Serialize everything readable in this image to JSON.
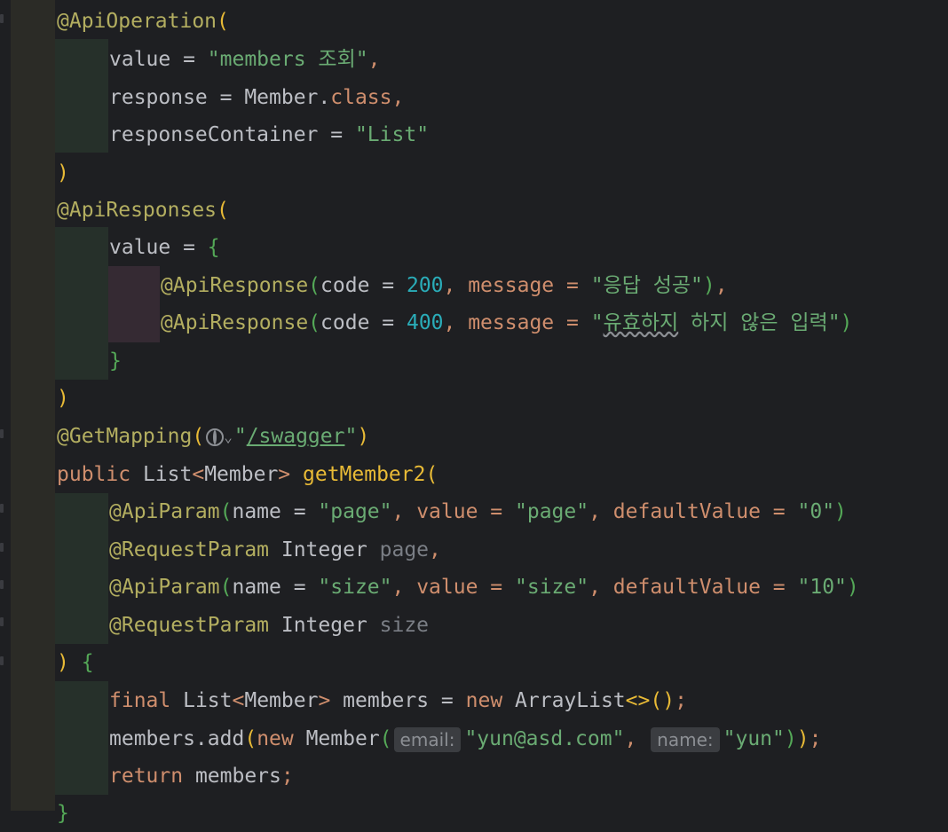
{
  "code": {
    "l1_annotation": "@ApiOperation",
    "l1_open": "(",
    "l2_key": "value = ",
    "l2_value": "\"members 조회\"",
    "l2_comma": ",",
    "l3_key": "response = Member.",
    "l3_kw": "class",
    "l3_comma": ",",
    "l4_key": "responseContainer = ",
    "l4_value": "\"List\"",
    "l5_close": ")",
    "l6_annotation": "@ApiResponses",
    "l6_open": "(",
    "l7_key": "value = ",
    "l7_brace": "{",
    "l8_annotation": "@ApiResponse",
    "l8_open": "(",
    "l8_code_key": "code = ",
    "l8_code_val": "200",
    "l8_msg_key": ", message = ",
    "l8_msg_val": "\"응답 성공\"",
    "l8_close": ")",
    "l8_comma": ",",
    "l9_annotation": "@ApiResponse",
    "l9_open": "(",
    "l9_code_key": "code = ",
    "l9_code_val": "400",
    "l9_msg_key": ", message = ",
    "l9_msg_q1": "\"",
    "l9_msg_typo": "유효하지",
    "l9_msg_rest": " 하지 않은 입력\"",
    "l9_close": ")",
    "l10_brace": "}",
    "l11_close": ")",
    "l12_annotation": "@GetMapping",
    "l12_open": "(",
    "l12_chevron": "⌄",
    "l12_q1": "\"",
    "l12_path": "/swagger",
    "l12_q2": "\"",
    "l12_close": ")",
    "l13_public": "public",
    "l13_list": " List",
    "l13_lt": "<",
    "l13_member": "Member",
    "l13_gt": ">",
    "l13_fn": " getMember2",
    "l13_open": "(",
    "l14_annotation": "@ApiParam",
    "l14_open": "(",
    "l14_k1": "name = ",
    "l14_v1": "\"page\"",
    "l14_k2": ", value = ",
    "l14_v2": "\"page\"",
    "l14_k3": ", defaultValue = ",
    "l14_v3": "\"0\"",
    "l14_close": ")",
    "l15_annotation": "@RequestParam",
    "l15_type": " Integer ",
    "l15_param": "page",
    "l15_comma": ",",
    "l16_annotation": "@ApiParam",
    "l16_open": "(",
    "l16_k1": "name = ",
    "l16_v1": "\"size\"",
    "l16_k2": ", value = ",
    "l16_v2": "\"size\"",
    "l16_k3": ", defaultValue = ",
    "l16_v3": "\"10\"",
    "l16_close": ")",
    "l17_annotation": "@RequestParam",
    "l17_type": " Integer ",
    "l17_param": "size",
    "l18_close": ")",
    "l18_brace": " {",
    "l19_final": "final",
    "l19_list": " List",
    "l19_lt": "<",
    "l19_member": "Member",
    "l19_gt": ">",
    "l19_mid": " members = ",
    "l19_new": "new",
    "l19_arr": " ArrayList",
    "l19_diamond": "<>",
    "l19_paren": "()",
    "l19_semi": ";",
    "l20_call": "members.add",
    "l20_open": "(",
    "l20_new": "new",
    "l20_member": " Member",
    "l20_open2": "(",
    "l20_hint1": "email:",
    "l20_v1": "\"yun@asd.com\"",
    "l20_comma": ", ",
    "l20_hint2": "name:",
    "l20_v2": "\"yun\"",
    "l20_close2": ")",
    "l20_close": ")",
    "l20_semi": ";",
    "l21_return": "return",
    "l21_rest": " members",
    "l21_semi": ";",
    "l22_brace": "}"
  }
}
